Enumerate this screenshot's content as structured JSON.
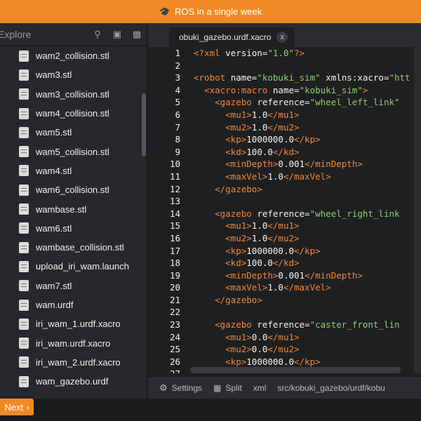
{
  "topbar": {
    "title": "ROS in a single week",
    "icon": "graduation-cap-icon"
  },
  "sidebar": {
    "title": "Explore",
    "icons": [
      "search-icon",
      "package-icon",
      "trash-icon"
    ],
    "files": [
      "wam2_collision.stl",
      "wam3.stl",
      "wam3_collision.stl",
      "wam4_collision.stl",
      "wam5.stl",
      "wam5_collision.stl",
      "wam4.stl",
      "wam6_collision.stl",
      "wambase.stl",
      "wam6.stl",
      "wambase_collision.stl",
      "upload_iri_wam.launch",
      "wam7.stl",
      "wam.urdf",
      "iri_wam_1.urdf.xacro",
      "iri_wam.urdf.xacro",
      "iri_wam_2.urdf.xacro",
      "wam_gazebo.urdf"
    ]
  },
  "editor": {
    "tab_label": "obuki_gazebo.urdf.xacro",
    "tab_close": "x",
    "lines": [
      {
        "n": "1",
        "c": [
          [
            "tag",
            "<?xml "
          ],
          [
            "attr",
            "version="
          ],
          [
            "str",
            "\"1.0\""
          ],
          [
            "tag",
            "?>"
          ]
        ]
      },
      {
        "n": "2",
        "c": []
      },
      {
        "n": "3",
        "c": [
          [
            "tag",
            "<robot "
          ],
          [
            "attr",
            "name="
          ],
          [
            "str",
            "\"kobuki_sim\""
          ],
          [
            "attr",
            " xmlns:xacro="
          ],
          [
            "str",
            "\"htt"
          ]
        ]
      },
      {
        "n": "4",
        "c": [
          [
            "text",
            "  "
          ],
          [
            "tag",
            "<xacro:macro "
          ],
          [
            "attr",
            "name="
          ],
          [
            "str",
            "\"kobuki_sim\""
          ],
          [
            "tag",
            ">"
          ]
        ]
      },
      {
        "n": "5",
        "c": [
          [
            "text",
            "    "
          ],
          [
            "tag",
            "<gazebo "
          ],
          [
            "attr",
            "reference="
          ],
          [
            "str",
            "\"wheel_left_link\""
          ]
        ]
      },
      {
        "n": "6",
        "c": [
          [
            "text",
            "      "
          ],
          [
            "tag",
            "<mu1>"
          ],
          [
            "text",
            "1.0"
          ],
          [
            "tag",
            "</mu1>"
          ]
        ]
      },
      {
        "n": "7",
        "c": [
          [
            "text",
            "      "
          ],
          [
            "tag",
            "<mu2>"
          ],
          [
            "text",
            "1.0"
          ],
          [
            "tag",
            "</mu2>"
          ]
        ]
      },
      {
        "n": "8",
        "c": [
          [
            "text",
            "      "
          ],
          [
            "tag",
            "<kp>"
          ],
          [
            "text",
            "1000000.0"
          ],
          [
            "tag",
            "</kp>"
          ]
        ]
      },
      {
        "n": "9",
        "c": [
          [
            "text",
            "      "
          ],
          [
            "tag",
            "<kd>"
          ],
          [
            "text",
            "100.0"
          ],
          [
            "tag",
            "</kd>"
          ]
        ]
      },
      {
        "n": "10",
        "c": [
          [
            "text",
            "      "
          ],
          [
            "tag",
            "<minDepth>"
          ],
          [
            "text",
            "0.001"
          ],
          [
            "tag",
            "</minDepth>"
          ]
        ]
      },
      {
        "n": "11",
        "c": [
          [
            "text",
            "      "
          ],
          [
            "tag",
            "<maxVel>"
          ],
          [
            "text",
            "1.0"
          ],
          [
            "tag",
            "</maxVel>"
          ]
        ]
      },
      {
        "n": "12",
        "c": [
          [
            "text",
            "    "
          ],
          [
            "tag",
            "</gazebo>"
          ]
        ]
      },
      {
        "n": "13",
        "c": []
      },
      {
        "n": "14",
        "c": [
          [
            "text",
            "    "
          ],
          [
            "tag",
            "<gazebo "
          ],
          [
            "attr",
            "reference="
          ],
          [
            "str",
            "\"wheel_right_link"
          ]
        ]
      },
      {
        "n": "15",
        "c": [
          [
            "text",
            "      "
          ],
          [
            "tag",
            "<mu1>"
          ],
          [
            "text",
            "1.0"
          ],
          [
            "tag",
            "</mu1>"
          ]
        ]
      },
      {
        "n": "16",
        "c": [
          [
            "text",
            "      "
          ],
          [
            "tag",
            "<mu2>"
          ],
          [
            "text",
            "1.0"
          ],
          [
            "tag",
            "</mu2>"
          ]
        ]
      },
      {
        "n": "17",
        "c": [
          [
            "text",
            "      "
          ],
          [
            "tag",
            "<kp>"
          ],
          [
            "text",
            "1000000.0"
          ],
          [
            "tag",
            "</kp>"
          ]
        ]
      },
      {
        "n": "18",
        "c": [
          [
            "text",
            "      "
          ],
          [
            "tag",
            "<kd>"
          ],
          [
            "text",
            "100.0"
          ],
          [
            "tag",
            "</kd>"
          ]
        ]
      },
      {
        "n": "19",
        "c": [
          [
            "text",
            "      "
          ],
          [
            "tag",
            "<minDepth>"
          ],
          [
            "text",
            "0.001"
          ],
          [
            "tag",
            "</minDepth>"
          ]
        ]
      },
      {
        "n": "20",
        "c": [
          [
            "text",
            "      "
          ],
          [
            "tag",
            "<maxVel>"
          ],
          [
            "text",
            "1.0"
          ],
          [
            "tag",
            "</maxVel>"
          ]
        ]
      },
      {
        "n": "21",
        "c": [
          [
            "text",
            "    "
          ],
          [
            "tag",
            "</gazebo>"
          ]
        ]
      },
      {
        "n": "22",
        "c": []
      },
      {
        "n": "23",
        "c": [
          [
            "text",
            "    "
          ],
          [
            "tag",
            "<gazebo "
          ],
          [
            "attr",
            "reference="
          ],
          [
            "str",
            "\"caster_front_lin"
          ]
        ]
      },
      {
        "n": "24",
        "c": [
          [
            "text",
            "      "
          ],
          [
            "tag",
            "<mu1>"
          ],
          [
            "text",
            "0.0"
          ],
          [
            "tag",
            "</mu1>"
          ]
        ]
      },
      {
        "n": "25",
        "c": [
          [
            "text",
            "      "
          ],
          [
            "tag",
            "<mu2>"
          ],
          [
            "text",
            "0.0"
          ],
          [
            "tag",
            "</mu2>"
          ]
        ]
      },
      {
        "n": "26",
        "c": [
          [
            "text",
            "      "
          ],
          [
            "tag",
            "<kp>"
          ],
          [
            "text",
            "1000000.0"
          ],
          [
            "tag",
            "</kp>"
          ]
        ]
      },
      {
        "n": "27",
        "c": []
      }
    ]
  },
  "statusbar": {
    "settings": "Settings",
    "split": "Split",
    "language": "xml",
    "path": "src/kobuki_gazebo/urdf/kobu"
  },
  "footer": {
    "next_label": "Next",
    "next_icon": "chevron-right-icon"
  },
  "colors": {
    "accent": "#f08a24",
    "tag": "#f08a3a",
    "string": "#8fd16f"
  }
}
